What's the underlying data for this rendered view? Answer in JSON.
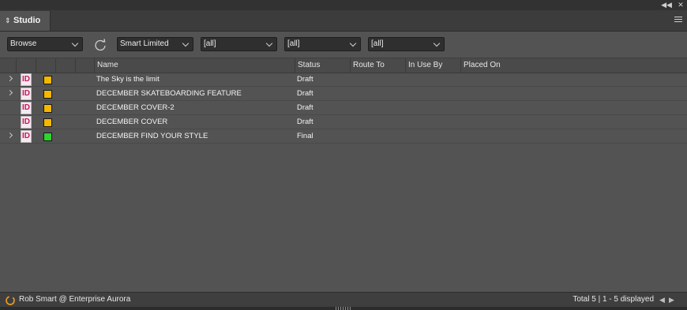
{
  "window": {
    "collapse_icon": "double-chevron-left-icon",
    "close_icon": "close-icon"
  },
  "tab": {
    "label": "Studio",
    "icon": "diamond-arrows-icon"
  },
  "toolbar": {
    "view_select": "Browse",
    "query_select": "Smart Limited",
    "filter1": "[all]",
    "filter2": "[all]",
    "filter3": "[all]"
  },
  "columns": {
    "name": "Name",
    "status": "Status",
    "route_to": "Route To",
    "in_use_by": "In Use By",
    "placed_on": "Placed On"
  },
  "rows": [
    {
      "name": "The Sky is the limit",
      "status": "Draft",
      "color": "#f5b800",
      "expandable": true
    },
    {
      "name": "DECEMBER SKATEBOARDING FEATURE",
      "status": "Draft",
      "color": "#f5b800",
      "expandable": true
    },
    {
      "name": "DECEMBER COVER-2",
      "status": "Draft",
      "color": "#f5b800",
      "expandable": false
    },
    {
      "name": "DECEMBER COVER",
      "status": "Draft",
      "color": "#f5b800",
      "expandable": false
    },
    {
      "name": "DECEMBER FIND YOUR STYLE",
      "status": "Final",
      "color": "#2ed52e",
      "expandable": true
    }
  ],
  "doc_icon_text": "ID",
  "footer": {
    "user": "Rob Smart @ Enterprise Aurora",
    "total": "Total 5 | 1 - 5 displayed"
  },
  "colors": {
    "accent_orange": "#f5b800",
    "accent_green": "#2ed52e",
    "indesign_pink": "#c3195d"
  }
}
